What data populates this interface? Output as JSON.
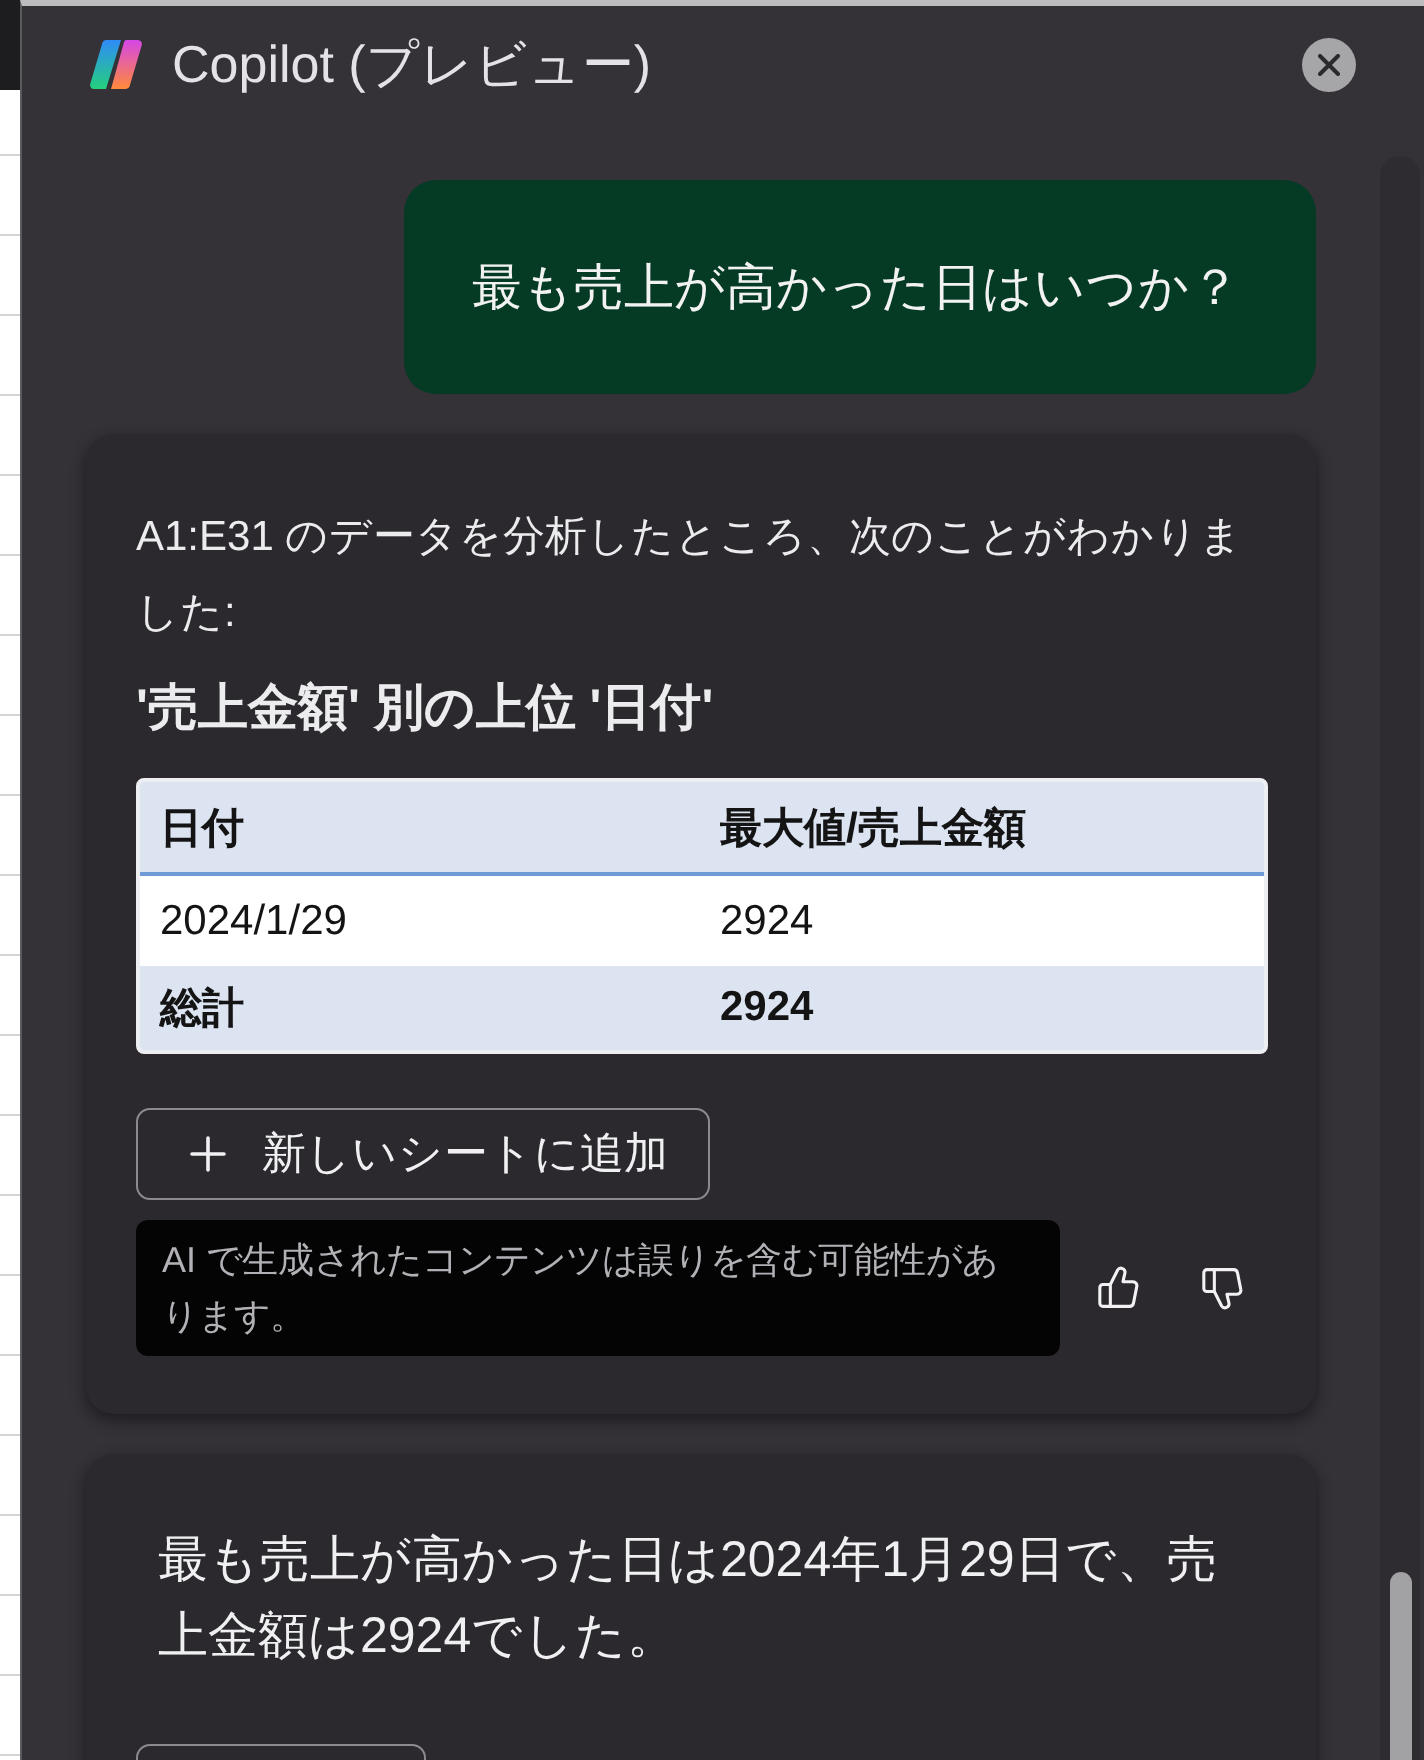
{
  "panel": {
    "title": "Copilot (プレビュー)"
  },
  "messages": [
    {
      "kind": "user",
      "text": "最も売上が高かった日はいつか？"
    },
    {
      "kind": "analysis",
      "intro": "A1:E31 のデータを分析したところ、次のことがわかりました:",
      "heading": "'売上金額' 別の上位 '日付'",
      "table": {
        "columns": [
          "日付",
          "最大値/売上金額"
        ],
        "rows": [
          {
            "kind": "data",
            "cells": [
              "2024/1/29",
              "2924"
            ]
          },
          {
            "kind": "total",
            "cells": [
              "総計",
              "2924"
            ]
          }
        ]
      },
      "action_button": "新しいシートに追加",
      "disclaimer": "AI で生成されたコンテンツは誤りを含む可能性があります。"
    },
    {
      "kind": "answer",
      "text": "最も売上が高かった日は2024年1月29日で、売上金額は2924でした。",
      "action_button_visible": true
    }
  ]
}
